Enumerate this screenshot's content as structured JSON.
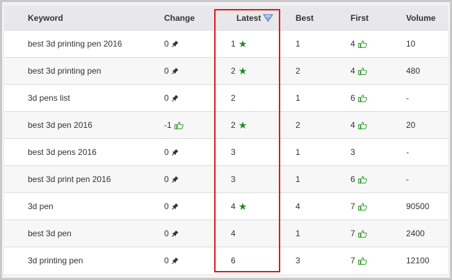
{
  "table": {
    "headers": {
      "keyword": "Keyword",
      "change": "Change",
      "latest": "Latest",
      "best": "Best",
      "first": "First",
      "volume": "Volume"
    },
    "sort_icon": "sort-down-arrow-icon",
    "rows": [
      {
        "keyword": "best 3d printing pen 2016",
        "change": "0",
        "change_icon": "pin-icon",
        "latest": "1",
        "latest_icon": "star-icon",
        "best": "1",
        "first": "4",
        "first_icon": "thumbs-up-icon",
        "volume": "10"
      },
      {
        "keyword": "best 3d printing pen",
        "change": "0",
        "change_icon": "pin-icon",
        "latest": "2",
        "latest_icon": "star-icon",
        "best": "2",
        "first": "4",
        "first_icon": "thumbs-up-icon",
        "volume": "480"
      },
      {
        "keyword": "3d pens list",
        "change": "0",
        "change_icon": "pin-icon",
        "latest": "2",
        "latest_icon": "",
        "best": "1",
        "first": "6",
        "first_icon": "thumbs-up-icon",
        "volume": "-"
      },
      {
        "keyword": "best 3d pen 2016",
        "change": "-1",
        "change_icon": "thumbs-up-icon",
        "latest": "2",
        "latest_icon": "star-icon",
        "best": "2",
        "first": "4",
        "first_icon": "thumbs-up-icon",
        "volume": "20"
      },
      {
        "keyword": "best 3d pens 2016",
        "change": "0",
        "change_icon": "pin-icon",
        "latest": "3",
        "latest_icon": "",
        "best": "1",
        "first": "3",
        "first_icon": "",
        "volume": "-"
      },
      {
        "keyword": "best 3d print pen 2016",
        "change": "0",
        "change_icon": "pin-icon",
        "latest": "3",
        "latest_icon": "",
        "best": "1",
        "first": "6",
        "first_icon": "thumbs-up-icon",
        "volume": "-"
      },
      {
        "keyword": "3d pen",
        "change": "0",
        "change_icon": "pin-icon",
        "latest": "4",
        "latest_icon": "star-icon",
        "best": "4",
        "first": "7",
        "first_icon": "thumbs-up-icon",
        "volume": "90500"
      },
      {
        "keyword": "best 3d pen",
        "change": "0",
        "change_icon": "pin-icon",
        "latest": "4",
        "latest_icon": "",
        "best": "1",
        "first": "7",
        "first_icon": "thumbs-up-icon",
        "volume": "2400"
      },
      {
        "keyword": "3d printing pen",
        "change": "0",
        "change_icon": "pin-icon",
        "latest": "6",
        "latest_icon": "",
        "best": "3",
        "first": "7",
        "first_icon": "thumbs-up-icon",
        "volume": "12100"
      }
    ]
  },
  "colors": {
    "star": "#1f8a1f",
    "thumb": "#2f9e2f",
    "highlight": "#e0181e",
    "header_bg": "#e8e8ec"
  }
}
